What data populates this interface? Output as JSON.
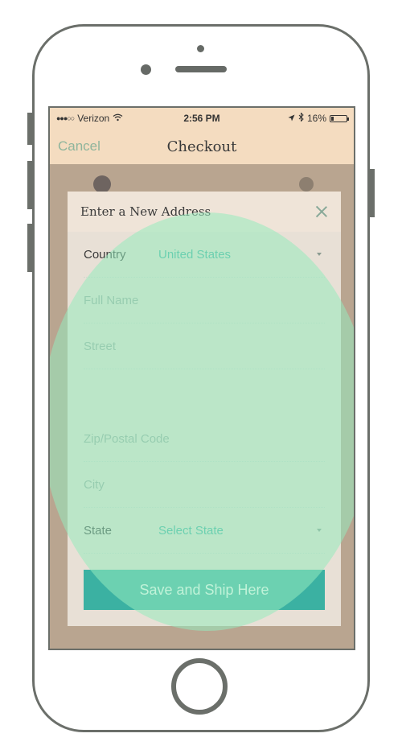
{
  "status": {
    "carrier": "Verizon",
    "time": "2:56 PM",
    "battery": "16%",
    "battery_level": 0.16
  },
  "nav": {
    "cancel_label": "Cancel",
    "title": "Checkout"
  },
  "modal": {
    "title": "Enter a New Address",
    "fields": {
      "country_label": "Country",
      "country_value": "United States",
      "full_name_placeholder": "Full Name",
      "street_placeholder": "Street",
      "zip_placeholder": "Zip/Postal Code",
      "city_placeholder": "City",
      "state_label": "State",
      "state_value": "Select State"
    },
    "save_label": "Save and Ship Here"
  },
  "colors": {
    "accent": "#3bb1a2",
    "header_bg": "#f4dcc0",
    "overlay": "#96ebbe"
  },
  "icons": {
    "close": "close-icon",
    "wifi": "wifi-icon",
    "location": "location-arrow-icon",
    "bluetooth": "bluetooth-icon",
    "battery": "battery-icon",
    "dropdown": "chevron-down-icon"
  }
}
